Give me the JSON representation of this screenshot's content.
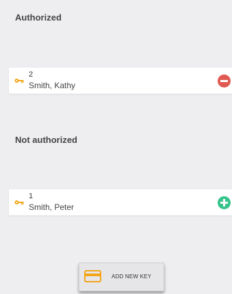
{
  "sections": {
    "authorized": {
      "title": "Authorized",
      "keys": [
        {
          "number": "2",
          "holder": "Smith, Kathy",
          "action": "remove"
        }
      ]
    },
    "not_authorized": {
      "title": "Not authorized",
      "keys": [
        {
          "number": "1",
          "holder": "Smith, Peter",
          "action": "add"
        }
      ]
    }
  },
  "add_key_button": {
    "label": "ADD NEW KEY"
  },
  "colors": {
    "background": "#eeeef1",
    "key_icon": "#f2a516",
    "remove": "#e05a52",
    "add": "#36c48b",
    "card_icon": "#f2a516"
  },
  "icons": {
    "key": "key-icon",
    "remove": "minus-circle-icon",
    "add": "plus-circle-icon",
    "card": "card-icon"
  }
}
